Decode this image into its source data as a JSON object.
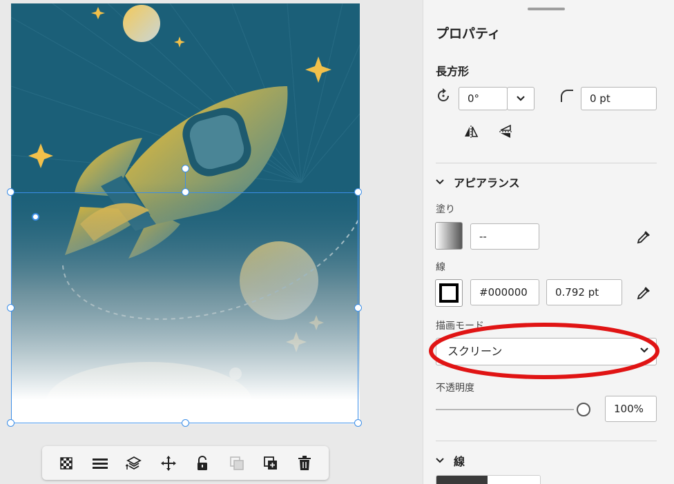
{
  "panel": {
    "title": "プロパティ",
    "object_type": "長方形",
    "rotation_value": "0°",
    "corner_radius_value": "0 pt",
    "appearance_label": "アピアランス",
    "fill_label": "塗り",
    "fill_value": "--",
    "stroke_label": "線",
    "stroke_color": "#000000",
    "stroke_width": "0.792 pt",
    "blend_mode_label": "描画モード",
    "blend_mode_value": "スクリーン",
    "opacity_label": "不透明度",
    "opacity_value": "100%",
    "opacity_level": 1.0,
    "stroke_section_label": "線"
  },
  "icons": {
    "rotate": "rotate-icon",
    "corner": "corner-radius-icon",
    "flip_h": "flip-horizontal-icon",
    "flip_v": "flip-vertical-icon",
    "eyedropper": "eyedropper-icon",
    "chevron": "chevron-down-icon"
  },
  "toolbar": {
    "items": [
      "transparency-grid-icon",
      "align-icon",
      "arrange-layers-icon",
      "move-icon",
      "lock-icon",
      "duplicate-disabled-icon",
      "add-duplicate-icon",
      "trash-icon"
    ]
  },
  "colors": {
    "selection": "#3b8ee8",
    "annotation": "#e01414",
    "sky": "#1b5f78",
    "rocket": "#f2b92e"
  }
}
